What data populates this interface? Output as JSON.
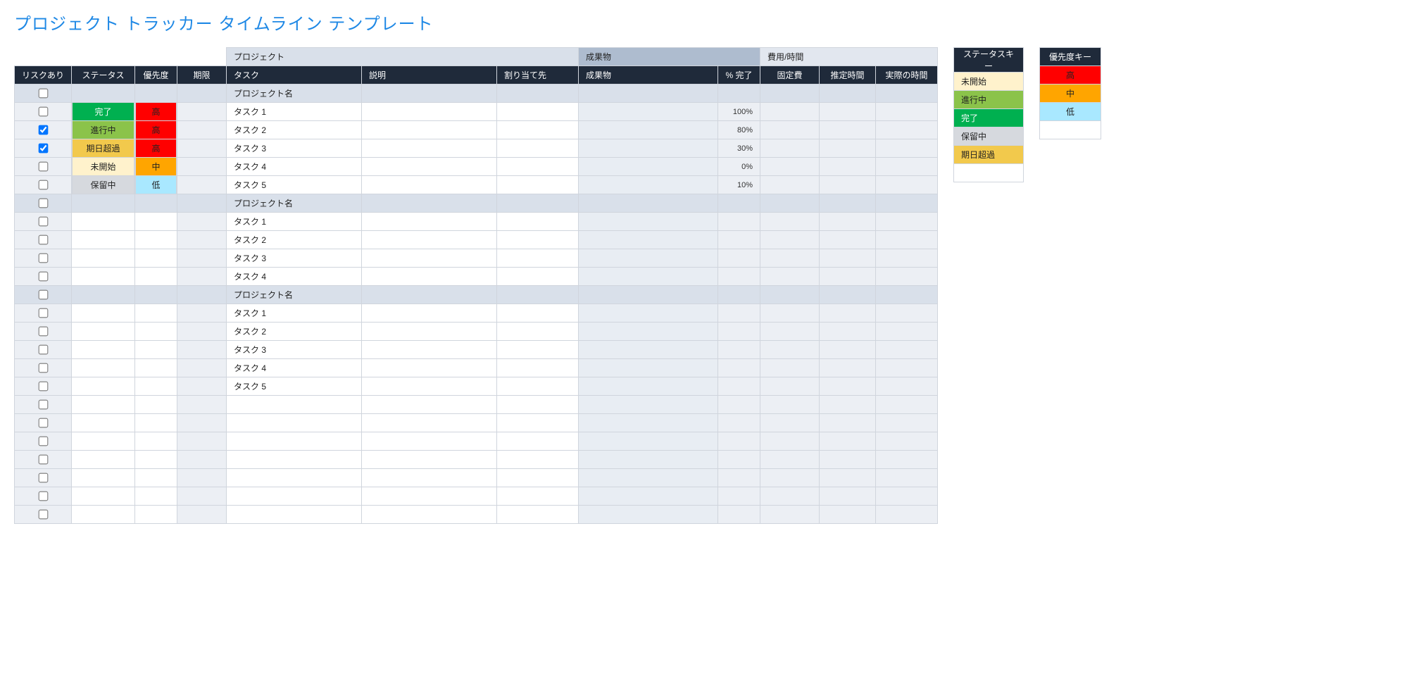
{
  "title": "プロジェクト トラッカー タイムライン テンプレート",
  "groupHeaders": {
    "project": "プロジェクト",
    "deliverables": "成果物",
    "costTime": "費用/時間"
  },
  "columns": {
    "risk": "リスクあり",
    "status": "ステータス",
    "priority": "優先度",
    "due": "期限",
    "task": "タスク",
    "desc": "説明",
    "assignee": "割り当て先",
    "deliverable": "成果物",
    "pct": "% 完了",
    "fixed": "固定費",
    "est": "推定時間",
    "actual": "実際の時間"
  },
  "statusKey": {
    "header": "ステータスキー",
    "items": [
      {
        "label": "未開始",
        "bg": "#fff2cc",
        "fg": "#222"
      },
      {
        "label": "進行中",
        "bg": "#8bc34a",
        "fg": "#222"
      },
      {
        "label": "完了",
        "bg": "#00b050",
        "fg": "#fff"
      },
      {
        "label": "保留中",
        "bg": "#d6d9de",
        "fg": "#222"
      },
      {
        "label": "期日超過",
        "bg": "#f2c94c",
        "fg": "#222"
      }
    ],
    "blankRows": 1
  },
  "priorityKey": {
    "header": "優先度キー",
    "items": [
      {
        "label": "高",
        "bg": "#ff0000",
        "fg": "#222"
      },
      {
        "label": "中",
        "bg": "#ffa500",
        "fg": "#222"
      },
      {
        "label": "低",
        "bg": "#a9e8ff",
        "fg": "#222"
      }
    ],
    "blankRows": 1
  },
  "rows": [
    {
      "kind": "project",
      "risk": false,
      "task": "プロジェクト名"
    },
    {
      "kind": "data",
      "risk": false,
      "status": "完了",
      "statusBg": "#00b050",
      "statusFg": "#fff",
      "priority": "高",
      "prioBg": "#ff0000",
      "prioFg": "#222",
      "task": "タスク 1",
      "pct": "100%"
    },
    {
      "kind": "data",
      "risk": true,
      "status": "進行中",
      "statusBg": "#8bc34a",
      "statusFg": "#222",
      "priority": "高",
      "prioBg": "#ff0000",
      "prioFg": "#222",
      "task": "タスク 2",
      "pct": "80%"
    },
    {
      "kind": "data",
      "risk": true,
      "status": "期日超過",
      "statusBg": "#f2c94c",
      "statusFg": "#222",
      "priority": "高",
      "prioBg": "#ff0000",
      "prioFg": "#222",
      "task": "タスク 3",
      "pct": "30%"
    },
    {
      "kind": "data",
      "risk": false,
      "status": "未開始",
      "statusBg": "#fff2cc",
      "statusFg": "#222",
      "priority": "中",
      "prioBg": "#ffa500",
      "prioFg": "#222",
      "task": "タスク 4",
      "pct": "0%"
    },
    {
      "kind": "data",
      "risk": false,
      "status": "保留中",
      "statusBg": "#d6d9de",
      "statusFg": "#222",
      "priority": "低",
      "prioBg": "#a9e8ff",
      "prioFg": "#222",
      "task": "タスク 5",
      "pct": "10%"
    },
    {
      "kind": "project",
      "risk": false,
      "task": "プロジェクト名"
    },
    {
      "kind": "data",
      "risk": false,
      "task": "タスク 1"
    },
    {
      "kind": "data",
      "risk": false,
      "task": "タスク 2"
    },
    {
      "kind": "data",
      "risk": false,
      "task": "タスク 3"
    },
    {
      "kind": "data",
      "risk": false,
      "task": "タスク 4"
    },
    {
      "kind": "project",
      "risk": false,
      "task": "プロジェクト名"
    },
    {
      "kind": "data",
      "risk": false,
      "task": "タスク 1"
    },
    {
      "kind": "data",
      "risk": false,
      "task": "タスク 2"
    },
    {
      "kind": "data",
      "risk": false,
      "task": "タスク 3"
    },
    {
      "kind": "data",
      "risk": false,
      "task": "タスク 4"
    },
    {
      "kind": "data",
      "risk": false,
      "task": "タスク 5"
    },
    {
      "kind": "data",
      "risk": false
    },
    {
      "kind": "data",
      "risk": false
    },
    {
      "kind": "data",
      "risk": false
    },
    {
      "kind": "data",
      "risk": false
    },
    {
      "kind": "data",
      "risk": false
    },
    {
      "kind": "data",
      "risk": false
    },
    {
      "kind": "data",
      "risk": false
    }
  ]
}
